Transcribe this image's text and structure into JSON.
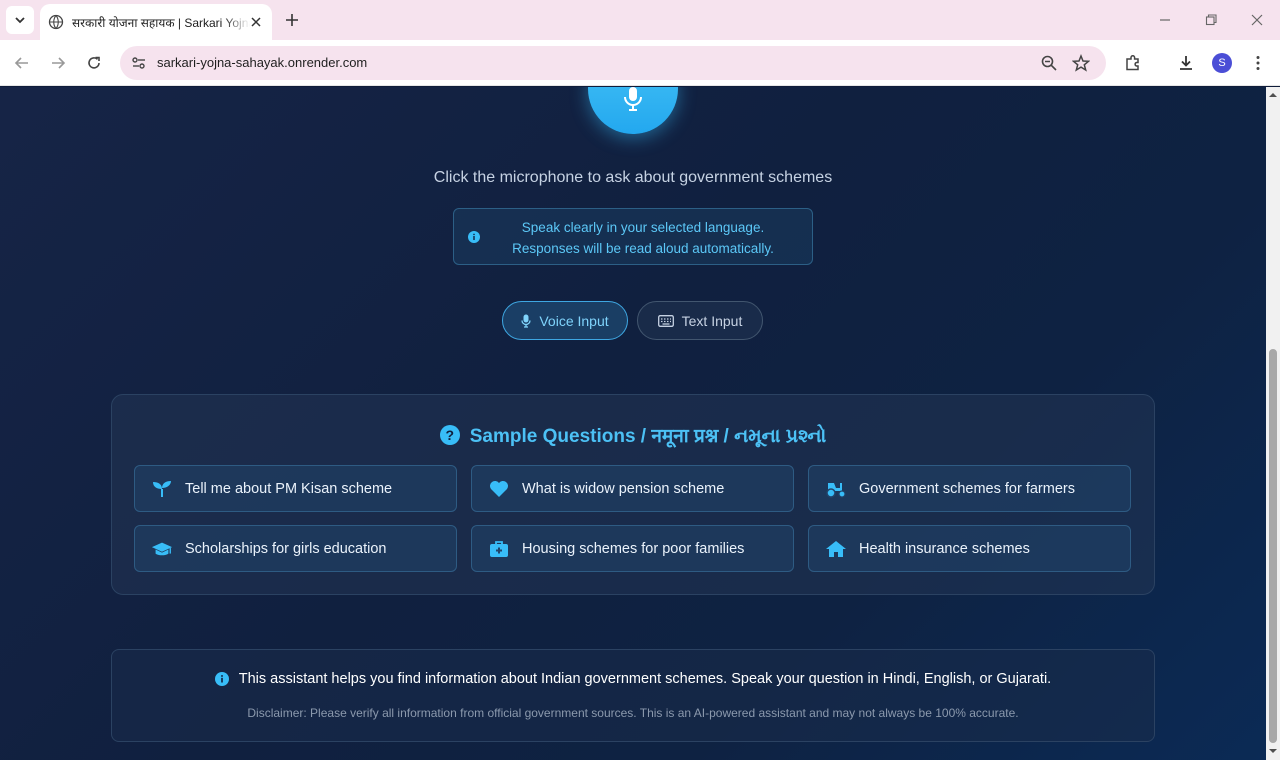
{
  "browser": {
    "tab_title": "सरकारी योजना सहायक | Sarkari Yojna Sahayak",
    "url": "sarkari-yojna-sahayak.onrender.com",
    "profile_initial": "S"
  },
  "colors": {
    "accent": "#38bdf8",
    "background": "#10203f",
    "chrome": "#f6e3ee"
  },
  "page": {
    "hint": "Click the microphone to ask about government schemes",
    "info": "Speak clearly in your selected language. Responses will be read aloud automatically.",
    "modes": {
      "voice": "Voice Input",
      "text": "Text Input",
      "selected": "voice"
    },
    "samples": {
      "title": "Sample Questions / नमूना प्रश्न / નમૂના પ્રશ્નો",
      "items": [
        {
          "label": "Tell me about PM Kisan scheme",
          "icon": "seedling-icon"
        },
        {
          "label": "What is widow pension scheme",
          "icon": "heart-icon"
        },
        {
          "label": "Government schemes for farmers",
          "icon": "tractor-icon"
        },
        {
          "label": "Scholarships for girls education",
          "icon": "graduation-cap-icon"
        },
        {
          "label": "Housing schemes for poor families",
          "icon": "medical-kit-icon"
        },
        {
          "label": "Health insurance schemes",
          "icon": "home-icon"
        }
      ]
    },
    "about": {
      "text": "This assistant helps you find information about Indian government schemes. Speak your question in Hindi, English, or Gujarati.",
      "disclaimer": "Disclaimer: Please verify all information from official government sources. This is an AI-powered assistant and may not always be 100% accurate."
    }
  }
}
